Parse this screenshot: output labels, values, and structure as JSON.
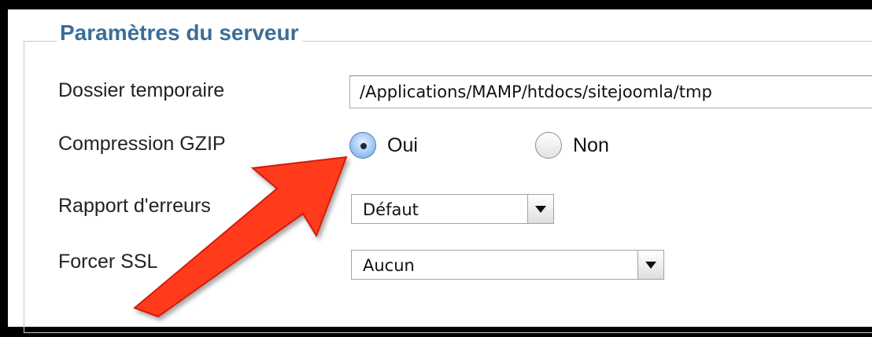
{
  "fieldset": {
    "legend": "Paramètres du serveur"
  },
  "form": {
    "temp_folder": {
      "label": "Dossier temporaire",
      "value": "/Applications/MAMP/htdocs/sitejoomla/tmp"
    },
    "gzip": {
      "label": "Compression GZIP",
      "options": [
        "Oui",
        "Non"
      ],
      "selected": "Oui"
    },
    "error_report": {
      "label": "Rapport d'erreurs",
      "value": "Défaut"
    },
    "force_ssl": {
      "label": "Forcer SSL",
      "value": "Aucun"
    }
  },
  "annotation": {
    "arrow_color": "#ff3b1f",
    "icon": "red-arrow-pointer"
  }
}
